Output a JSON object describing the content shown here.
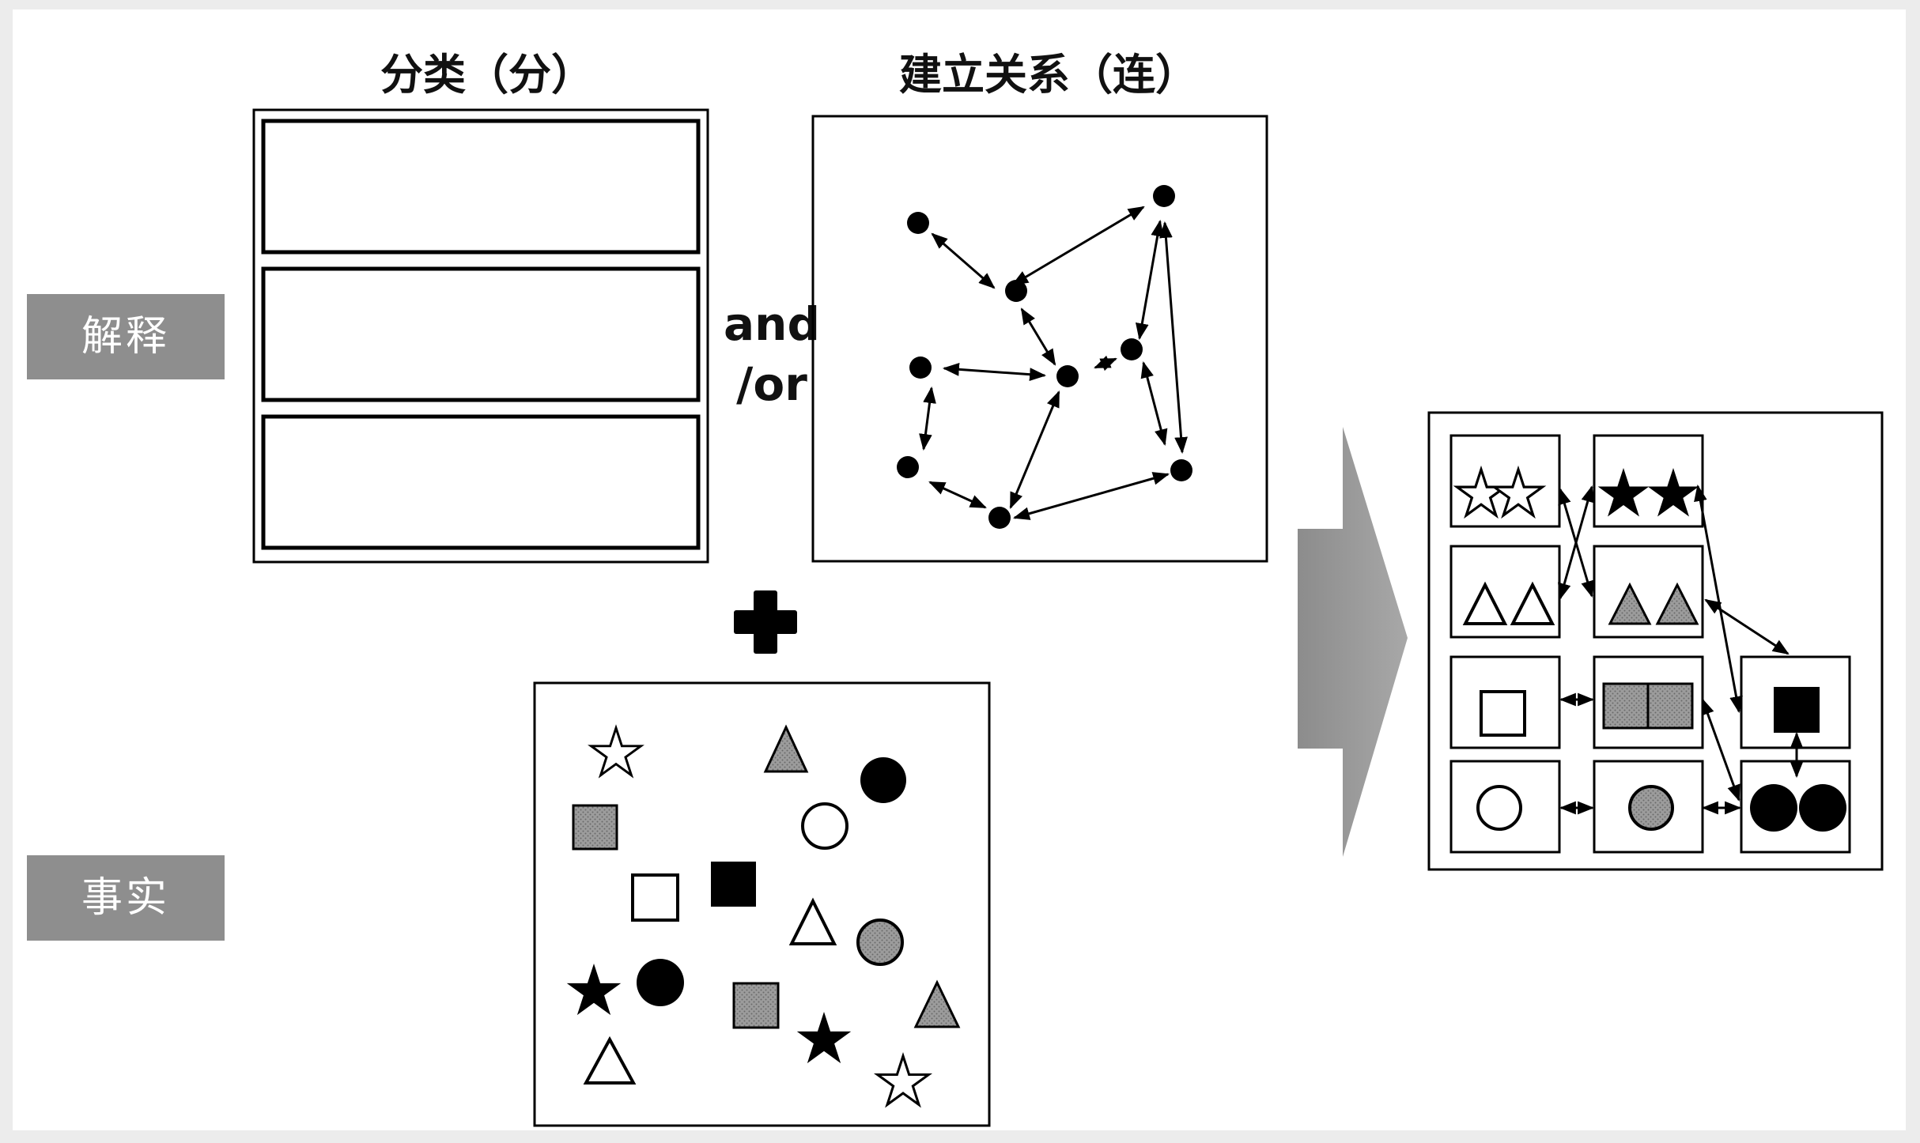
{
  "labels": {
    "interpretation": "解释",
    "facts": "事实"
  },
  "columns": {
    "classify": "分类（分）",
    "relate": "建立关系（连）"
  },
  "connector": {
    "line1": "and",
    "line2": "/or"
  },
  "colors": {
    "label_bg": "#8e8e8e",
    "gray_fill": "#8a8a8a",
    "arrow_fill": "#9a9a9a",
    "ink": "#000000"
  },
  "icons": [
    "star",
    "triangle",
    "square",
    "circle",
    "plus",
    "arrow-right"
  ]
}
